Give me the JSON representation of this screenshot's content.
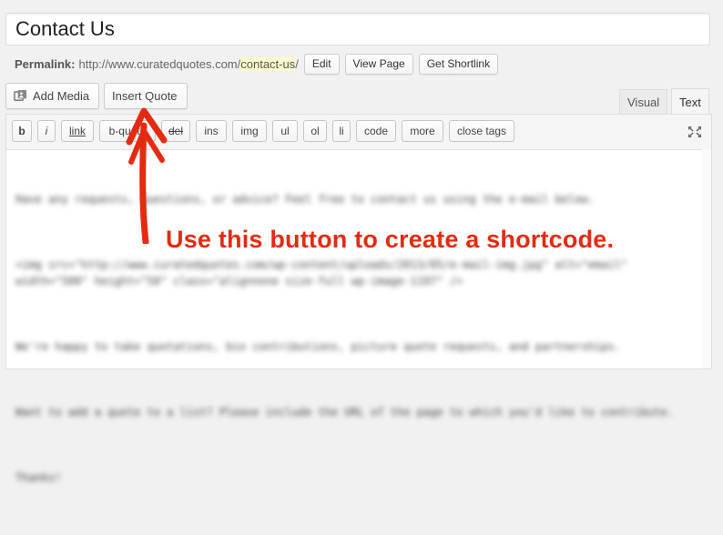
{
  "post": {
    "title": "Contact Us"
  },
  "permalink": {
    "label": "Permalink:",
    "base": "http://www.curatedquotes.com/",
    "slug": "contact-us",
    "trailing": "/",
    "edit_label": "Edit",
    "view_label": "View Page",
    "shortlink_label": "Get Shortlink"
  },
  "media_buttons": {
    "add_media": "Add Media",
    "insert_quote": "Insert Quote"
  },
  "editor_tabs": {
    "visual": "Visual",
    "text": "Text",
    "active": "Text"
  },
  "quicktags": [
    "b",
    "i",
    "link",
    "b-quote",
    "del",
    "ins",
    "img",
    "ul",
    "ol",
    "li",
    "code",
    "more",
    "close tags"
  ],
  "content": {
    "paragraphs": [
      "Have any requests, questions, or advice? Feel free to contact us using the e-mail below.",
      "<img src=\"http://www.curatedquotes.com/wp-content/uploads/2013/05/e-mail-img.jpg\" alt=\"email\" width=\"500\" height=\"50\" class=\"alignnone size-full wp-image-1197\" />",
      "We're happy to take quotations, bio contributions, picture quote requests, and partnerships.",
      "Want to add a quote to a list? Please include the URL of the page to which you'd like to contribute.",
      "Thanks!"
    ]
  },
  "annotation": {
    "text": "Use this button to create a shortcode.",
    "color": "#e42b12"
  }
}
